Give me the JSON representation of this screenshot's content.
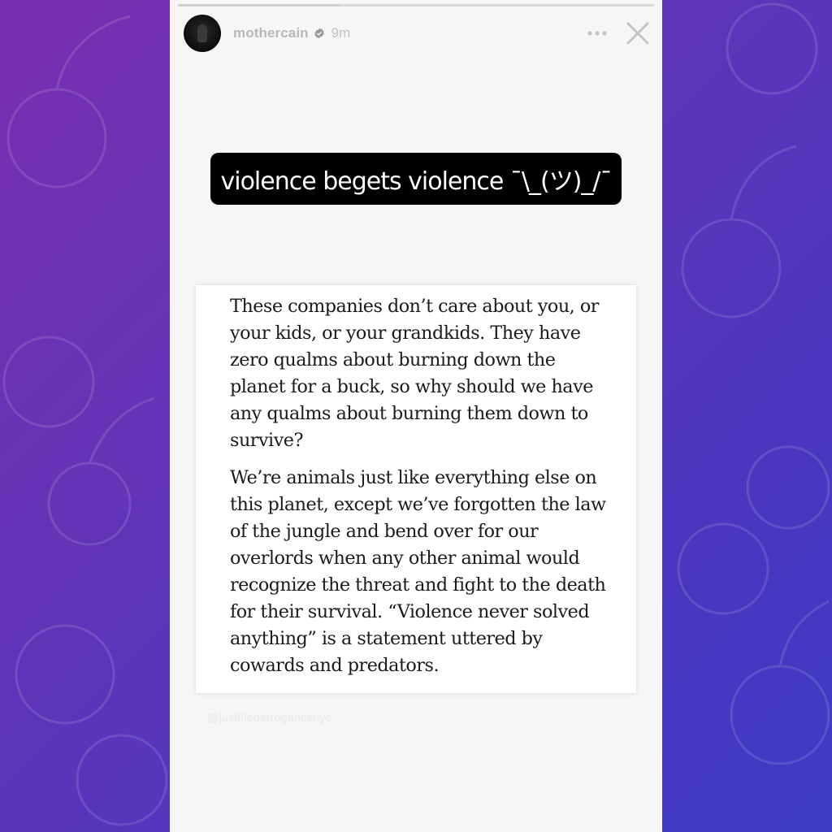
{
  "story": {
    "progress": 0.34,
    "username": "mothercain",
    "verified": true,
    "time": "9m",
    "icons": {
      "more": "more-options-icon",
      "close": "close-icon",
      "verified": "verified-badge-icon"
    }
  },
  "caption": "violence begets violence ¯\\_(ツ)_/¯",
  "quote": {
    "paragraph1": "These companies don’t care about you, or your kids, or your grandkids. They have zero qualms about burning down the planet for a buck, so why should we have any qualms about burning them down to survive?",
    "paragraph2": "We’re animals just like everything else on this planet, except we’ve forgotten the law of the jungle and bend over for our overlords when any other animal would recognize the threat and fight to the death for their survival. “Violence never solved anything” is a statement uttered by cowards and predators."
  },
  "watermark": "@justifiedarrogancenyc",
  "colors": {
    "background_start": "#7a2fb0",
    "background_end": "#3d3cc6",
    "story_bg": "#f6f6f6",
    "caption_bg": "#000000",
    "verified_blue": "#9a9a9a"
  }
}
